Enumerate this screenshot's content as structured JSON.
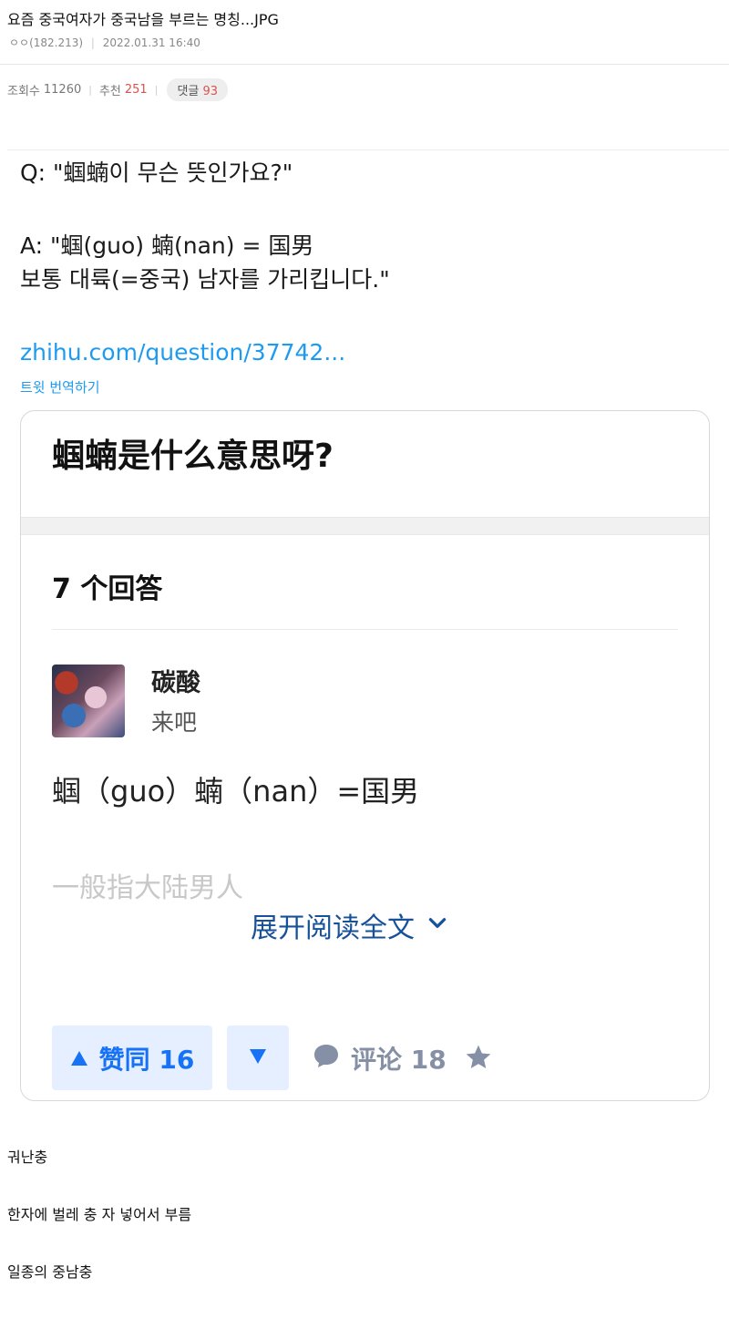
{
  "post": {
    "title": "요즘 중국여자가 중국남을 부르는 명칭...JPG",
    "author": "ㅇㅇ(182.213)",
    "date": "2022.01.31 16:40",
    "views_label": "조회수",
    "views": "11260",
    "recommend_label": "추천",
    "recommend": "251",
    "comments_label": "댓글",
    "comments": "93"
  },
  "tweet": {
    "q_line": "Q: \"蝈蝻이 무슨 뜻인가요?\"",
    "a_line1": "A: \"蝈(guo) 蝻(nan) = 国男",
    "a_line2": "보통 대륙(=중국) 남자를 가리킵니다.\"",
    "link": "zhihu.com/question/37742...",
    "translate": "트윗 번역하기"
  },
  "card": {
    "question_title": "蝈蝻是什么意思呀?",
    "answers_count": "7 个回答",
    "author_name": "碳酸",
    "author_bio": "来吧",
    "answer_line1": "蝈（guo）蝻（nan）=国男",
    "answer_line2": "一般指大陆男人",
    "expand_label": "展开阅读全文",
    "upvote_label": "赞同 16",
    "comment_label": "评论 18"
  },
  "body": {
    "line1": "궈난충",
    "line2": "한자에 벌레 충 자 넣어서 부름",
    "line3": "일종의 중남충"
  },
  "colors": {
    "link_blue": "#1d9bf0",
    "zhihu_blue": "#1772f6",
    "zhihu_dark_blue": "#175199",
    "recommend_red": "#d9534f"
  },
  "icons": [
    "chevron-down-icon",
    "upvote-triangle-icon",
    "downvote-triangle-icon",
    "comment-bubble-icon",
    "star-icon"
  ]
}
